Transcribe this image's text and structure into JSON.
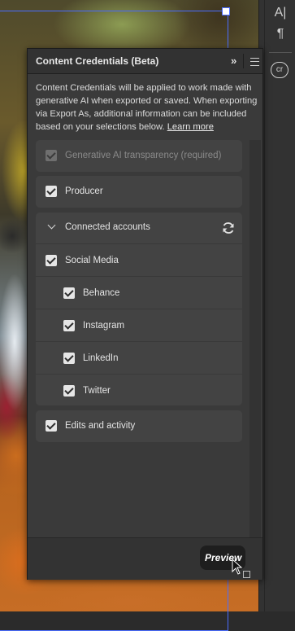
{
  "panel": {
    "title": "Content Credentials (Beta)",
    "description": "Content Credentials will be applied to work made with generative AI when exported or saved. When exporting via Export As, additional information can be included based on your selections below.",
    "learn_more": "Learn more"
  },
  "options": {
    "generative_ai": {
      "label": "Generative AI transparency (required)",
      "checked": true,
      "disabled": true
    },
    "producer": {
      "label": "Producer",
      "checked": true
    },
    "connected_accounts": {
      "label": "Connected accounts",
      "expanded": true
    },
    "social_media": {
      "label": "Social Media",
      "checked": true
    },
    "behance": {
      "label": "Behance",
      "checked": true
    },
    "instagram": {
      "label": "Instagram",
      "checked": true
    },
    "linkedin": {
      "label": "LinkedIn",
      "checked": true
    },
    "twitter": {
      "label": "Twitter",
      "checked": true
    },
    "edits_activity": {
      "label": "Edits and activity",
      "checked": true
    }
  },
  "footer": {
    "preview_label": "Preview"
  },
  "toolstrip": {
    "character_icon": "A|",
    "paragraph_icon": "¶",
    "cr_icon": "cr"
  },
  "colors": {
    "panel_bg": "#3a3a3a",
    "row_bg": "#434343",
    "accent_frame": "#4a6cff"
  }
}
